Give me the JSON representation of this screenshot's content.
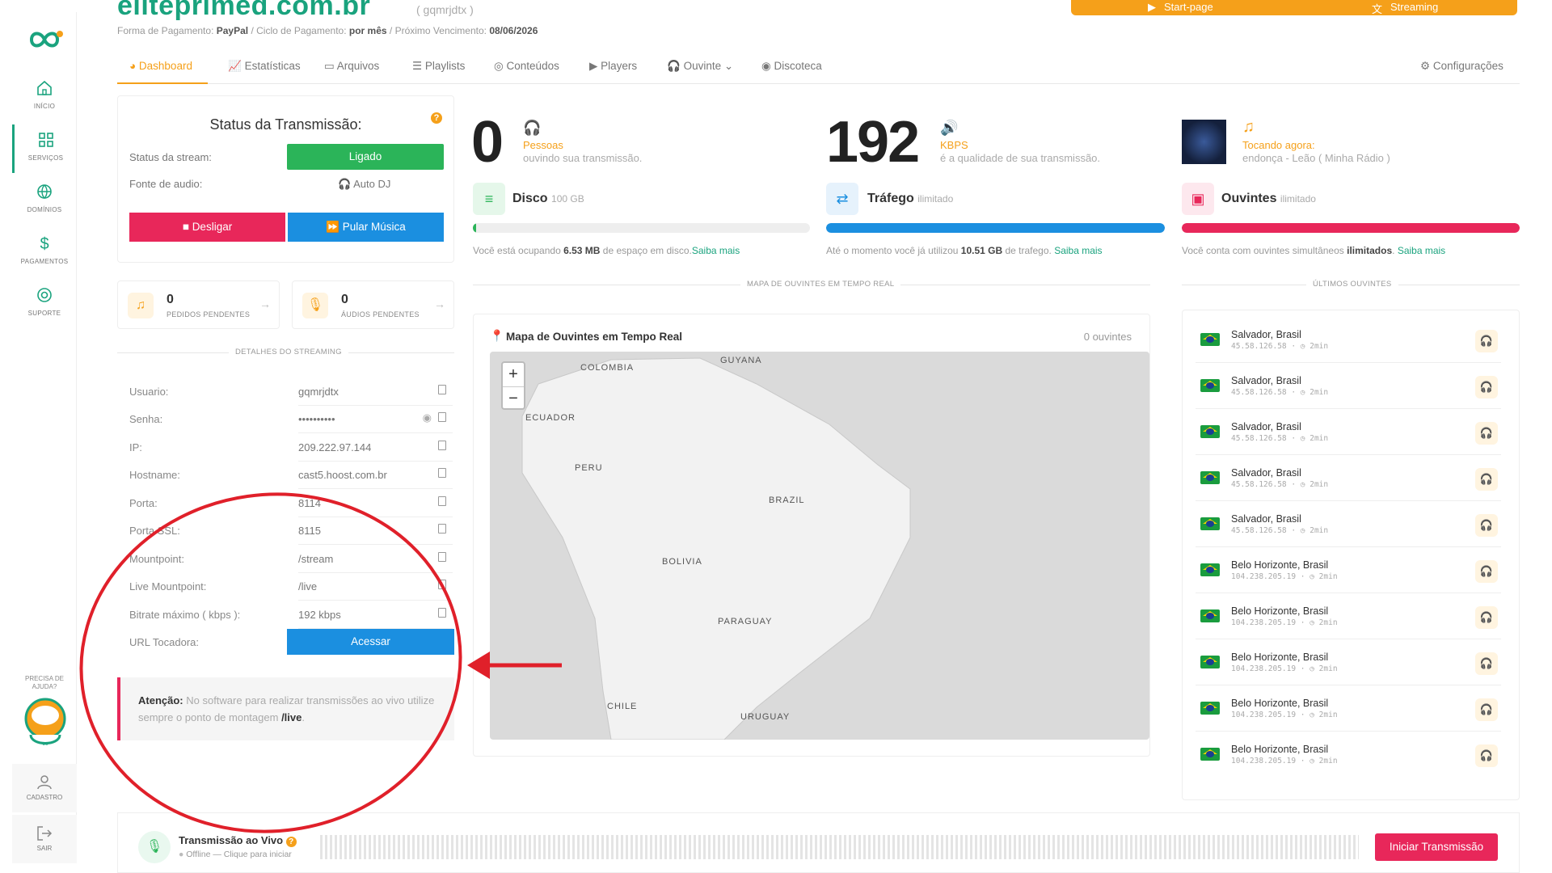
{
  "brand": {
    "name": "eliteprimed.com.br",
    "account": "( gqmrjdtx )"
  },
  "payment": {
    "prefix": "Forma de Pagamento:",
    "method": "PayPal",
    "cycle_lbl": "/ Ciclo de Pagamento:",
    "cycle": "por mês",
    "due_lbl": "/ Próximo Vencimento:",
    "due": "08/06/2026"
  },
  "topbar": {
    "start_page": "Start-page",
    "streaming": "Streaming"
  },
  "sidebar": {
    "items": [
      "INÍCIO",
      "SERVIÇOS",
      "DOMÍNIOS",
      "PAGAMENTOS",
      "SUPORTE"
    ],
    "help": "PRECISA DE AJUDA?",
    "cadastro": "CADASTRO",
    "sair": "SAIR"
  },
  "tabs": [
    "Dashboard",
    "Estatísticas",
    "Arquivos",
    "Playlists",
    "Conteúdos",
    "Players",
    "Ouvinte",
    "Discoteca"
  ],
  "settings": "Configurações",
  "status": {
    "title": "Status da Transmissão:",
    "stream_lbl": "Status da stream:",
    "stream_val": "Ligado",
    "source_lbl": "Fonte de audio:",
    "source_val": "Auto DJ",
    "off_btn": "Desligar",
    "skip_btn": "Pular Música",
    "help": "?"
  },
  "pending": {
    "requests_num": "0",
    "requests_lbl": "PEDIDOS PENDENTES",
    "audios_num": "0",
    "audios_lbl": "ÁUDIOS PENDENTES"
  },
  "details": {
    "header": "DETALHES DO STREAMING",
    "rows": [
      {
        "k": "Usuario:",
        "v": "gqmrjdtx"
      },
      {
        "k": "Senha:",
        "v": "••••••••••"
      },
      {
        "k": "IP:",
        "v": "209.222.97.144"
      },
      {
        "k": "Hostname:",
        "v": "cast5.hoost.com.br"
      },
      {
        "k": "Porta:",
        "v": "8114"
      },
      {
        "k": "Porta SSL:",
        "v": "8115"
      },
      {
        "k": "Mountpoint:",
        "v": "/stream"
      },
      {
        "k": "Live Mountpoint:",
        "v": "/live"
      },
      {
        "k": "Bitrate máximo ( kbps ):",
        "v": "192 kbps"
      },
      {
        "k": "URL Tocadora:",
        "v": "Acessar"
      }
    ]
  },
  "alert": {
    "strong": "Atenção:",
    "text": " No software para realizar transmissões ao vivo utilize sempre o ponto de montagem ",
    "mount": "/live",
    "end": "."
  },
  "stats": {
    "listeners_num": "0",
    "listeners_lbl": "Pessoas",
    "listeners_sub": "ouvindo sua transmissão.",
    "kbps_num": "192",
    "kbps_lbl": "KBPS",
    "kbps_sub": "é a qualidade de sua transmissão.",
    "playing_lbl": "Tocando agora:",
    "playing_sub": "endonça - Leão ( Minha Rádio )"
  },
  "resources": {
    "disk": {
      "title": "Disco",
      "cap": "100 GB",
      "pct": 0.01,
      "color": "#2bb459",
      "note_a": "Você está ocupando ",
      "note_b": "6.53 MB",
      "note_c": " de espaço em disco.",
      "link": "Saiba mais"
    },
    "traffic": {
      "title": "Tráfego",
      "cap": "ilimitado",
      "pct": 1.0,
      "color": "#1b8fe0",
      "note_a": "Até o momento você já utilizou ",
      "note_b": "10.51 GB",
      "note_c": " de trafego. ",
      "link": "Saiba mais"
    },
    "listeners": {
      "title": "Ouvintes",
      "cap": "ilimitado",
      "pct": 1.0,
      "color": "#e8275a",
      "note_a": "Você conta com ouvintes simultâneos ",
      "note_b": "ilimitados",
      "note_c": ". ",
      "link": "Saiba mais"
    }
  },
  "map": {
    "header": "MAPA DE OUVINTES EM TEMPO REAL",
    "title": "Mapa de Ouvintes em Tempo Real",
    "count": "0 ouvintes",
    "zoom_in": "+",
    "zoom_out": "−",
    "countries": [
      "COLOMBIA",
      "GUYANA",
      "ECUADOR",
      "PERU",
      "BRAZIL",
      "BOLIVIA",
      "PARAGUAY",
      "CHILE",
      "URUGUAY"
    ]
  },
  "last_listeners": {
    "header": "ÚLTIMOS OUVINTES",
    "items": [
      {
        "city": "Salvador, Brasil",
        "ip": "45.58.126.58 · ◷ 2min"
      },
      {
        "city": "Salvador, Brasil",
        "ip": "45.58.126.58 · ◷ 2min"
      },
      {
        "city": "Salvador, Brasil",
        "ip": "45.58.126.58 · ◷ 2min"
      },
      {
        "city": "Salvador, Brasil",
        "ip": "45.58.126.58 · ◷ 2min"
      },
      {
        "city": "Salvador, Brasil",
        "ip": "45.58.126.58 · ◷ 2min"
      },
      {
        "city": "Belo Horizonte, Brasil",
        "ip": "104.238.205.19 · ◷ 2min"
      },
      {
        "city": "Belo Horizonte, Brasil",
        "ip": "104.238.205.19 · ◷ 2min"
      },
      {
        "city": "Belo Horizonte, Brasil",
        "ip": "104.238.205.19 · ◷ 2min"
      },
      {
        "city": "Belo Horizonte, Brasil",
        "ip": "104.238.205.19 · ◷ 2min"
      },
      {
        "city": "Belo Horizonte, Brasil",
        "ip": "104.238.205.19 · ◷ 2min"
      }
    ]
  },
  "live": {
    "title": "Transmissão ao Vivo",
    "sub": "Offline — Clique para iniciar",
    "button": "Iniciar Transmissão"
  },
  "colors": {
    "accent": "#f5a01a",
    "brand": "#1aa37e",
    "danger": "#e8275a",
    "primary": "#1b8fe0",
    "success": "#2bb459",
    "annotation": "#e0202a"
  }
}
